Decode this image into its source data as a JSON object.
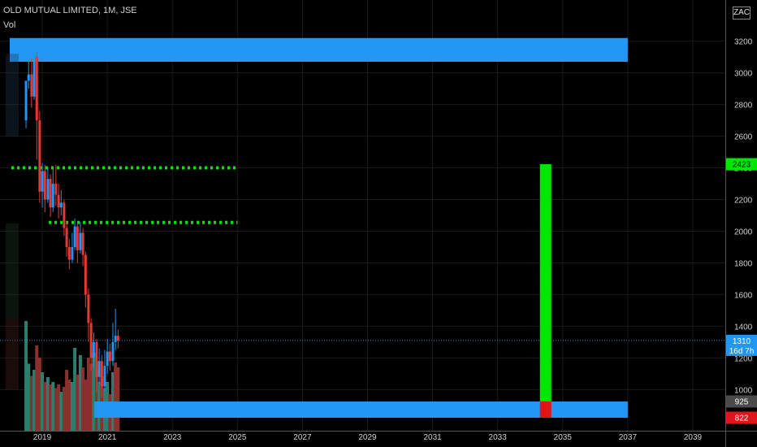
{
  "header": {
    "symbol_line": "OLD MUTUAL LIMITED, 1M, JSE",
    "volume_label": "Vol",
    "currency_badge": "ZAC"
  },
  "chart_data": {
    "type": "candlestick",
    "y_axis": {
      "ticks": [
        1000,
        1200,
        1400,
        1600,
        1800,
        2000,
        2200,
        2400,
        2600,
        2800,
        3000,
        3200
      ],
      "ylim": [
        740,
        3460
      ]
    },
    "x_axis": {
      "ticks": [
        "2019",
        "2021",
        "2023",
        "2025",
        "2027",
        "2029",
        "2031",
        "2033",
        "2035",
        "2037",
        "2039"
      ],
      "xlim": [
        2017.7,
        2040.0
      ]
    },
    "price_labels": [
      {
        "id": "target",
        "text": "2423",
        "value": 2423,
        "bg": "#00e600",
        "fg": "#000000"
      },
      {
        "id": "last",
        "text": "1310",
        "subtext": "16d 7h",
        "value": 1310,
        "bg": "#2196f3",
        "fg": "#ffffff"
      },
      {
        "id": "support",
        "text": "925",
        "value": 925,
        "bg": "#4a4a4a",
        "fg": "#ffffff"
      },
      {
        "id": "stop",
        "text": "822",
        "value": 822,
        "bg": "#e0151b",
        "fg": "#ffffff"
      }
    ],
    "zones": [
      {
        "name": "upper-zone",
        "x0": 2018.0,
        "x1": 2037.0,
        "y0": 3070,
        "y1": 3220,
        "color": "#2196f3"
      },
      {
        "name": "lower-zone",
        "x0": 2020.6,
        "x1": 2037.0,
        "y0": 822,
        "y1": 925,
        "color": "#2196f3"
      }
    ],
    "levels": [
      {
        "name": "level-2400",
        "x0": 2018.05,
        "x1": 2025.0,
        "y": 2400,
        "color": "#00e600"
      },
      {
        "name": "level-2055",
        "x0": 2019.2,
        "x1": 2025.0,
        "y": 2055,
        "color": "#00e600"
      }
    ],
    "last_price": 1310,
    "position": {
      "x0": 2034.3,
      "x1": 2034.65,
      "entry": 925,
      "target": 2423,
      "stop": 822,
      "profit_color": "#00e600",
      "loss_color": "#e0151b"
    },
    "candles": [
      [
        2018.5,
        2700,
        2950,
        2950,
        2650
      ],
      [
        2018.58,
        2950,
        2990,
        3080,
        2900
      ],
      [
        2018.67,
        2990,
        2850,
        3090,
        2780
      ],
      [
        2018.75,
        2850,
        3100,
        3110,
        2830
      ],
      [
        2018.83,
        3100,
        2700,
        3130,
        2450
      ],
      [
        2018.92,
        2700,
        2250,
        2760,
        2180
      ],
      [
        2019.0,
        2250,
        2380,
        2430,
        2150
      ],
      [
        2019.08,
        2380,
        2200,
        2420,
        2120
      ],
      [
        2019.17,
        2200,
        2330,
        2400,
        2180
      ],
      [
        2019.25,
        2330,
        2150,
        2360,
        2090
      ],
      [
        2019.33,
        2150,
        2300,
        2400,
        2120
      ],
      [
        2019.42,
        2300,
        2230,
        2420,
        2160
      ],
      [
        2019.5,
        2230,
        2150,
        2300,
        2080
      ],
      [
        2019.58,
        2150,
        2180,
        2260,
        2100
      ],
      [
        2019.67,
        2180,
        2020,
        2200,
        1970
      ],
      [
        2019.75,
        2020,
        1900,
        2060,
        1840
      ],
      [
        2019.83,
        1900,
        1820,
        1950,
        1760
      ],
      [
        2019.92,
        1820,
        1900,
        1990,
        1800
      ],
      [
        2020.0,
        1900,
        2030,
        2080,
        1880
      ],
      [
        2020.08,
        2030,
        1880,
        2050,
        1800
      ],
      [
        2020.17,
        1880,
        1990,
        2060,
        1860
      ],
      [
        2020.25,
        1990,
        1850,
        2020,
        1780
      ],
      [
        2020.33,
        1850,
        1600,
        1870,
        1520
      ],
      [
        2020.42,
        1600,
        1420,
        1640,
        1300
      ],
      [
        2020.5,
        1420,
        1200,
        1450,
        1120
      ],
      [
        2020.58,
        1200,
        1300,
        1360,
        1140
      ],
      [
        2020.67,
        1300,
        1080,
        1320,
        980
      ],
      [
        2020.75,
        1080,
        1180,
        1260,
        1040
      ],
      [
        2020.83,
        1180,
        1020,
        1220,
        950
      ],
      [
        2020.92,
        1020,
        1150,
        1250,
        990
      ],
      [
        2021.0,
        1150,
        1240,
        1320,
        1100
      ],
      [
        2021.08,
        1240,
        1180,
        1290,
        1120
      ],
      [
        2021.17,
        1180,
        1300,
        1420,
        1150
      ],
      [
        2021.25,
        1300,
        1340,
        1510,
        1250
      ],
      [
        2021.33,
        1340,
        1310,
        1380,
        1260
      ]
    ],
    "volume": [
      {
        "x": 2018.5,
        "v": 90,
        "up": true
      },
      {
        "x": 2018.58,
        "v": 55,
        "up": true
      },
      {
        "x": 2018.67,
        "v": 45,
        "up": false
      },
      {
        "x": 2018.75,
        "v": 50,
        "up": true
      },
      {
        "x": 2018.83,
        "v": 70,
        "up": false
      },
      {
        "x": 2018.92,
        "v": 60,
        "up": false
      },
      {
        "x": 2019.0,
        "v": 48,
        "up": true
      },
      {
        "x": 2019.08,
        "v": 40,
        "up": false
      },
      {
        "x": 2019.17,
        "v": 44,
        "up": true
      },
      {
        "x": 2019.25,
        "v": 38,
        "up": false
      },
      {
        "x": 2019.33,
        "v": 40,
        "up": true
      },
      {
        "x": 2019.42,
        "v": 35,
        "up": false
      },
      {
        "x": 2019.5,
        "v": 38,
        "up": false
      },
      {
        "x": 2019.58,
        "v": 32,
        "up": true
      },
      {
        "x": 2019.67,
        "v": 36,
        "up": false
      },
      {
        "x": 2019.75,
        "v": 50,
        "up": false
      },
      {
        "x": 2019.83,
        "v": 42,
        "up": false
      },
      {
        "x": 2019.92,
        "v": 40,
        "up": true
      },
      {
        "x": 2020.0,
        "v": 68,
        "up": true
      },
      {
        "x": 2020.08,
        "v": 46,
        "up": false
      },
      {
        "x": 2020.17,
        "v": 62,
        "up": true
      },
      {
        "x": 2020.25,
        "v": 52,
        "up": false
      },
      {
        "x": 2020.33,
        "v": 42,
        "up": false
      },
      {
        "x": 2020.42,
        "v": 60,
        "up": false
      },
      {
        "x": 2020.5,
        "v": 55,
        "up": false
      },
      {
        "x": 2020.58,
        "v": 64,
        "up": true
      },
      {
        "x": 2020.67,
        "v": 50,
        "up": false
      },
      {
        "x": 2020.75,
        "v": 40,
        "up": true
      },
      {
        "x": 2020.83,
        "v": 45,
        "up": false
      },
      {
        "x": 2020.92,
        "v": 35,
        "up": true
      },
      {
        "x": 2021.0,
        "v": 40,
        "up": true
      },
      {
        "x": 2021.08,
        "v": 30,
        "up": false
      },
      {
        "x": 2021.17,
        "v": 48,
        "up": true
      },
      {
        "x": 2021.25,
        "v": 56,
        "up": false
      },
      {
        "x": 2021.33,
        "v": 52,
        "up": false
      }
    ],
    "colors": {
      "up": "#2196f3",
      "down": "#e53935",
      "vol_up": "#2a7f6f",
      "vol_down": "#8b2f2f",
      "grid": "#1a1a1a",
      "axis_text": "#cfcfcf"
    }
  }
}
